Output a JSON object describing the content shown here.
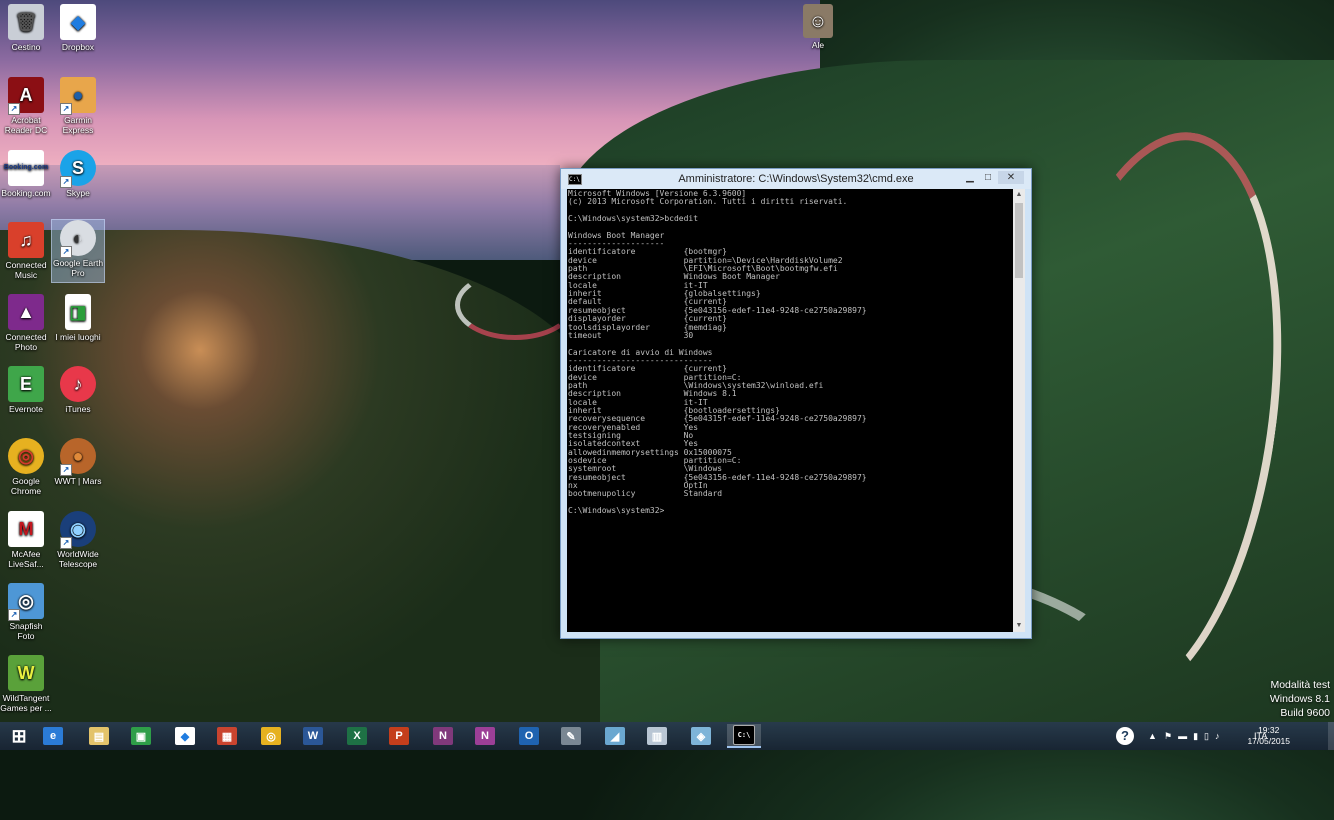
{
  "desktop": {
    "icons": [
      {
        "label": "Cestino",
        "glyph": "🗑",
        "bg": "#c9ced6",
        "color": "#555"
      },
      {
        "label": "Dropbox",
        "glyph": "◆",
        "bg": "#ffffff",
        "color": "#1f7ce0"
      },
      {
        "label": "Acrobat Reader DC",
        "glyph": "A",
        "bg": "#8b0f14",
        "color": "#ffffff"
      },
      {
        "label": "Garmin Express",
        "glyph": "●",
        "bg": "#e8a64b",
        "color": "#1e5fa8"
      },
      {
        "label": "Booking.com",
        "glyph": "Booking.com",
        "bg": "#ffffff",
        "color": "#1b3b87"
      },
      {
        "label": "Skype",
        "glyph": "S",
        "bg": "#1aa3e8",
        "color": "#ffffff"
      },
      {
        "label": "Connected Music",
        "glyph": "♫",
        "bg": "#d9402b",
        "color": "#ffffff"
      },
      {
        "label": "Google Earth Pro",
        "glyph": "◐",
        "bg": "#d9dde2",
        "color": "#333"
      },
      {
        "label": "Connected Photo",
        "glyph": "▲",
        "bg": "#7e2a8c",
        "color": "#ffffff"
      },
      {
        "label": "I miei luoghi",
        "glyph": "◨",
        "bg": "#ffffff",
        "color": "#2a9e3a"
      },
      {
        "label": "Evernote",
        "glyph": "E",
        "bg": "#3fa64a",
        "color": "#ffffff"
      },
      {
        "label": "iTunes",
        "glyph": "♪",
        "bg": "#e8384a",
        "color": "#ffffff"
      },
      {
        "label": "Google Chrome",
        "glyph": "◎",
        "bg": "#e6b120",
        "color": "#d23a2d"
      },
      {
        "label": "WWT | Mars",
        "glyph": "●",
        "bg": "#b8652a",
        "color": "#e08a3a"
      },
      {
        "label": "McAfee LiveSaf...",
        "glyph": "M",
        "bg": "#ffffff",
        "color": "#c2161e"
      },
      {
        "label": "WorldWide Telescope",
        "glyph": "◉",
        "bg": "#1a3f7a",
        "color": "#8fd0ff"
      },
      {
        "label": "Snapfish Foto",
        "glyph": "◎",
        "bg": "#4e97d6",
        "color": "#ffffff"
      },
      {
        "label": "WildTangent Games per ...",
        "glyph": "W",
        "bg": "#5aa13a",
        "color": "#e8f040"
      },
      {
        "label": "Ale",
        "glyph": "☺",
        "bg": "#8a7a66",
        "color": "#ffffff"
      }
    ]
  },
  "cmd_window": {
    "title": "Amministratore: C:\\Windows\\System32\\cmd.exe",
    "minimize": "▁",
    "maximize": "□",
    "close": "✕",
    "scroll_up": "▲",
    "scroll_down": "▼",
    "lines": [
      "Microsoft Windows [Versione 6.3.9600]",
      "(c) 2013 Microsoft Corporation. Tutti i diritti riservati.",
      "",
      "C:\\Windows\\system32>bcdedit",
      "",
      "Windows Boot Manager",
      "--------------------",
      "identificatore          {bootmgr}",
      "device                  partition=\\Device\\HarddiskVolume2",
      "path                    \\EFI\\Microsoft\\Boot\\bootmgfw.efi",
      "description             Windows Boot Manager",
      "locale                  it-IT",
      "inherit                 {globalsettings}",
      "default                 {current}",
      "resumeobject            {5e043156-edef-11e4-9248-ce2750a29897}",
      "displayorder            {current}",
      "toolsdisplayorder       {memdiag}",
      "timeout                 30",
      "",
      "Caricatore di avvio di Windows",
      "------------------------------",
      "identificatore          {current}",
      "device                  partition=C:",
      "path                    \\Windows\\system32\\winload.efi",
      "description             Windows 8.1",
      "locale                  it-IT",
      "inherit                 {bootloadersettings}",
      "recoverysequence        {5e04315f-edef-11e4-9248-ce2750a29897}",
      "recoveryenabled         Yes",
      "testsigning             No",
      "isolatedcontext         Yes",
      "allowedinmemorysettings 0x15000075",
      "osdevice                partition=C:",
      "systemroot              \\Windows",
      "resumeobject            {5e043156-edef-11e4-9248-ce2750a29897}",
      "nx                      OptIn",
      "bootmenupolicy          Standard",
      "",
      "C:\\Windows\\system32>"
    ]
  },
  "watermark": {
    "line1": "Modalità test",
    "line2": "Windows 8.1",
    "line3": "Build 9600"
  },
  "taskbar": {
    "start_glyph": "⊞",
    "pinned": [
      {
        "name": "internet-explorer",
        "glyph": "e",
        "bg": "#2b7bd6"
      },
      {
        "name": "file-explorer",
        "glyph": "▤",
        "bg": "#e3c36a"
      },
      {
        "name": "store",
        "glyph": "▣",
        "bg": "#2e9e48"
      },
      {
        "name": "dropbox",
        "glyph": "◆",
        "bg": "#ffffff"
      },
      {
        "name": "photos",
        "glyph": "▦",
        "bg": "#c9442f"
      },
      {
        "name": "chrome",
        "glyph": "◎",
        "bg": "#e6b120"
      },
      {
        "name": "word",
        "glyph": "W",
        "bg": "#2b5797"
      },
      {
        "name": "excel",
        "glyph": "X",
        "bg": "#1e7145"
      },
      {
        "name": "powerpoint",
        "glyph": "P",
        "bg": "#c43e1c"
      },
      {
        "name": "onenote",
        "glyph": "N",
        "bg": "#80397b"
      },
      {
        "name": "onenote-2013",
        "glyph": "N",
        "bg": "#9c3f97"
      },
      {
        "name": "outlook",
        "glyph": "O",
        "bg": "#1f63b0"
      },
      {
        "name": "app-1",
        "glyph": "✎",
        "bg": "#7a8793"
      },
      {
        "name": "app-2",
        "glyph": "◢",
        "bg": "#6aa7d0"
      },
      {
        "name": "app-3",
        "glyph": "▥",
        "bg": "#b9c6d4"
      },
      {
        "name": "app-4",
        "glyph": "◈",
        "bg": "#7eb4d8"
      },
      {
        "name": "command-prompt",
        "glyph": "C:\\",
        "bg": "#000000"
      }
    ],
    "help_glyph": "?",
    "tray_chevron": "▲",
    "tray_icons": [
      "⚑",
      "▬",
      "▮",
      "▯",
      "♪"
    ],
    "language": "ITA",
    "time": "19:32",
    "date": "17/05/2015"
  }
}
